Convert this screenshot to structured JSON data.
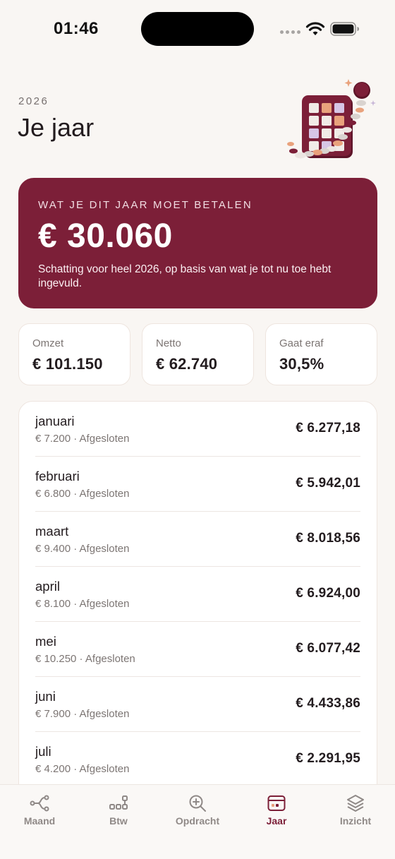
{
  "status_bar": {
    "time": "01:46"
  },
  "header": {
    "year": "2026",
    "title": "Je jaar"
  },
  "summary": {
    "caption": "WAT JE DIT JAAR MOET BETALEN",
    "amount": "€ 30.060",
    "note": "Schatting voor heel 2026, op basis van wat je tot nu toe hebt ingevuld."
  },
  "stats": [
    {
      "label": "Omzet",
      "value": "€ 101.150"
    },
    {
      "label": "Netto",
      "value": "€ 62.740"
    },
    {
      "label": "Gaat eraf",
      "value": "30,5%"
    }
  ],
  "months": [
    {
      "name": "januari",
      "meta": "€ 7.200 · Afgesloten",
      "amount": "€ 6.277,18"
    },
    {
      "name": "februari",
      "meta": "€ 6.800 · Afgesloten",
      "amount": "€ 5.942,01"
    },
    {
      "name": "maart",
      "meta": "€ 9.400 · Afgesloten",
      "amount": "€ 8.018,56"
    },
    {
      "name": "april",
      "meta": "€ 8.100 · Afgesloten",
      "amount": "€ 6.924,00"
    },
    {
      "name": "mei",
      "meta": "€ 10.250 · Afgesloten",
      "amount": "€ 6.077,42"
    },
    {
      "name": "juni",
      "meta": "€ 7.900 · Afgesloten",
      "amount": "€ 4.433,86"
    },
    {
      "name": "juli",
      "meta": "€ 4.200 · Afgesloten",
      "amount": "€ 2.291,95"
    }
  ],
  "tabs": [
    {
      "label": "Maand",
      "icon": "share-nodes-icon",
      "active": false
    },
    {
      "label": "Btw",
      "icon": "blocks-icon",
      "active": false
    },
    {
      "label": "Opdracht",
      "icon": "zoom-in-icon",
      "active": false
    },
    {
      "label": "Jaar",
      "icon": "calendar-card-icon",
      "active": true
    },
    {
      "label": "Inzicht",
      "icon": "layers-icon",
      "active": false
    }
  ],
  "colors": {
    "accent": "#7c1f38",
    "background": "#f9f6f3",
    "inactive_tab": "#8f8987"
  }
}
